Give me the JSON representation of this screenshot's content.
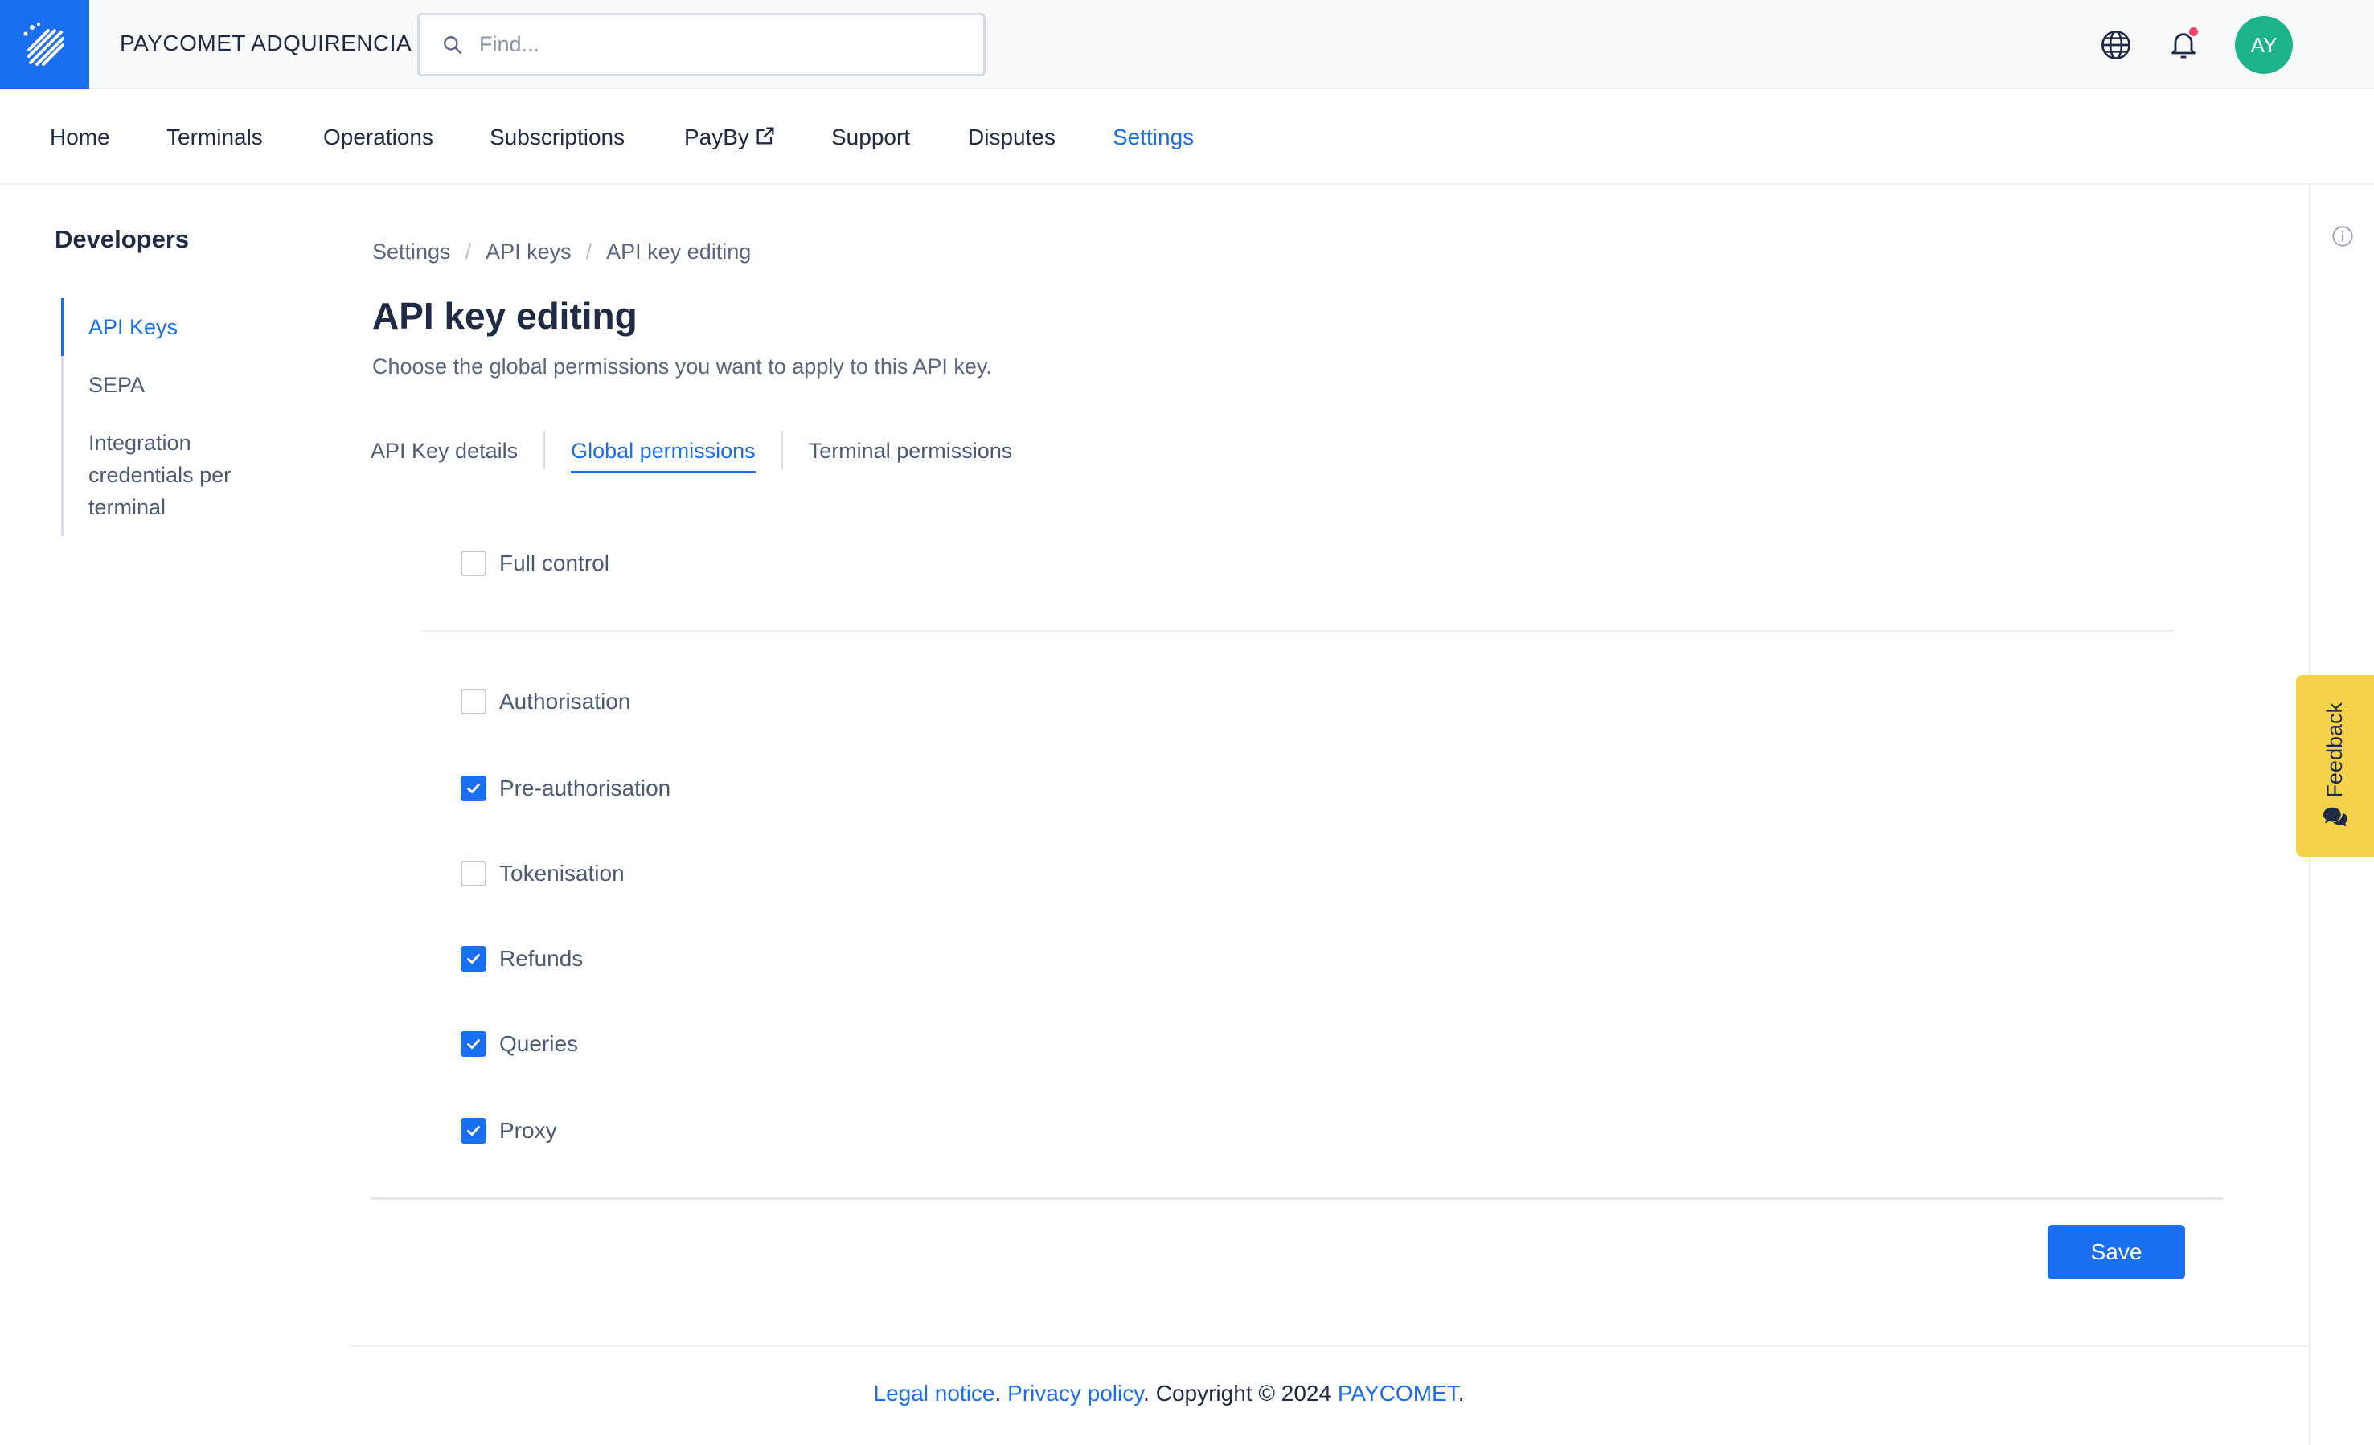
{
  "header": {
    "brand": "PAYCOMET ADQUIRENCIA",
    "search_placeholder": "Find...",
    "avatar_initials": "AY"
  },
  "nav": {
    "items": [
      {
        "label": "Home"
      },
      {
        "label": "Terminals"
      },
      {
        "label": "Operations"
      },
      {
        "label": "Subscriptions"
      },
      {
        "label": "PayBy"
      },
      {
        "label": "Support"
      },
      {
        "label": "Disputes"
      },
      {
        "label": "Settings"
      }
    ],
    "active": "Settings"
  },
  "sidebar": {
    "title": "Developers",
    "items": [
      {
        "label": "API Keys"
      },
      {
        "label": "SEPA"
      },
      {
        "label": "Integration credentials per terminal"
      }
    ],
    "active": "API Keys"
  },
  "breadcrumb": {
    "items": [
      "Settings",
      "API keys",
      "API key editing"
    ],
    "separator": "/"
  },
  "page": {
    "title": "API key editing",
    "subtitle": "Choose the global permissions you want to apply to this API key."
  },
  "tabs": {
    "items": [
      {
        "label": "API Key details"
      },
      {
        "label": "Global permissions"
      },
      {
        "label": "Terminal permissions"
      }
    ],
    "active": "Global permissions"
  },
  "permissions": {
    "full_control": {
      "label": "Full control",
      "checked": false
    },
    "items": [
      {
        "label": "Authorisation",
        "checked": false
      },
      {
        "label": "Pre-authorisation",
        "checked": true
      },
      {
        "label": "Tokenisation",
        "checked": false
      },
      {
        "label": "Refunds",
        "checked": true
      },
      {
        "label": "Queries",
        "checked": true
      },
      {
        "label": "Proxy",
        "checked": true
      }
    ]
  },
  "actions": {
    "save_label": "Save"
  },
  "feedback": {
    "label": "Feedback"
  },
  "footer": {
    "legal": "Legal notice",
    "sep1": ". ",
    "privacy": "Privacy policy",
    "copyright": ". Copyright © 2024 ",
    "company": "PAYCOMET",
    "end": "."
  },
  "colors": {
    "accent": "#1a6ef0",
    "avatar": "#1db38b",
    "feedback": "#f6d24a",
    "notification": "#f0436a"
  },
  "icons": {
    "logo": "paycomet-logo-icon",
    "search": "search-icon",
    "language": "globe-icon",
    "notifications": "bell-icon",
    "external": "external-link-icon",
    "info": "info-icon",
    "feedback": "chat-icon",
    "check": "check-icon"
  }
}
